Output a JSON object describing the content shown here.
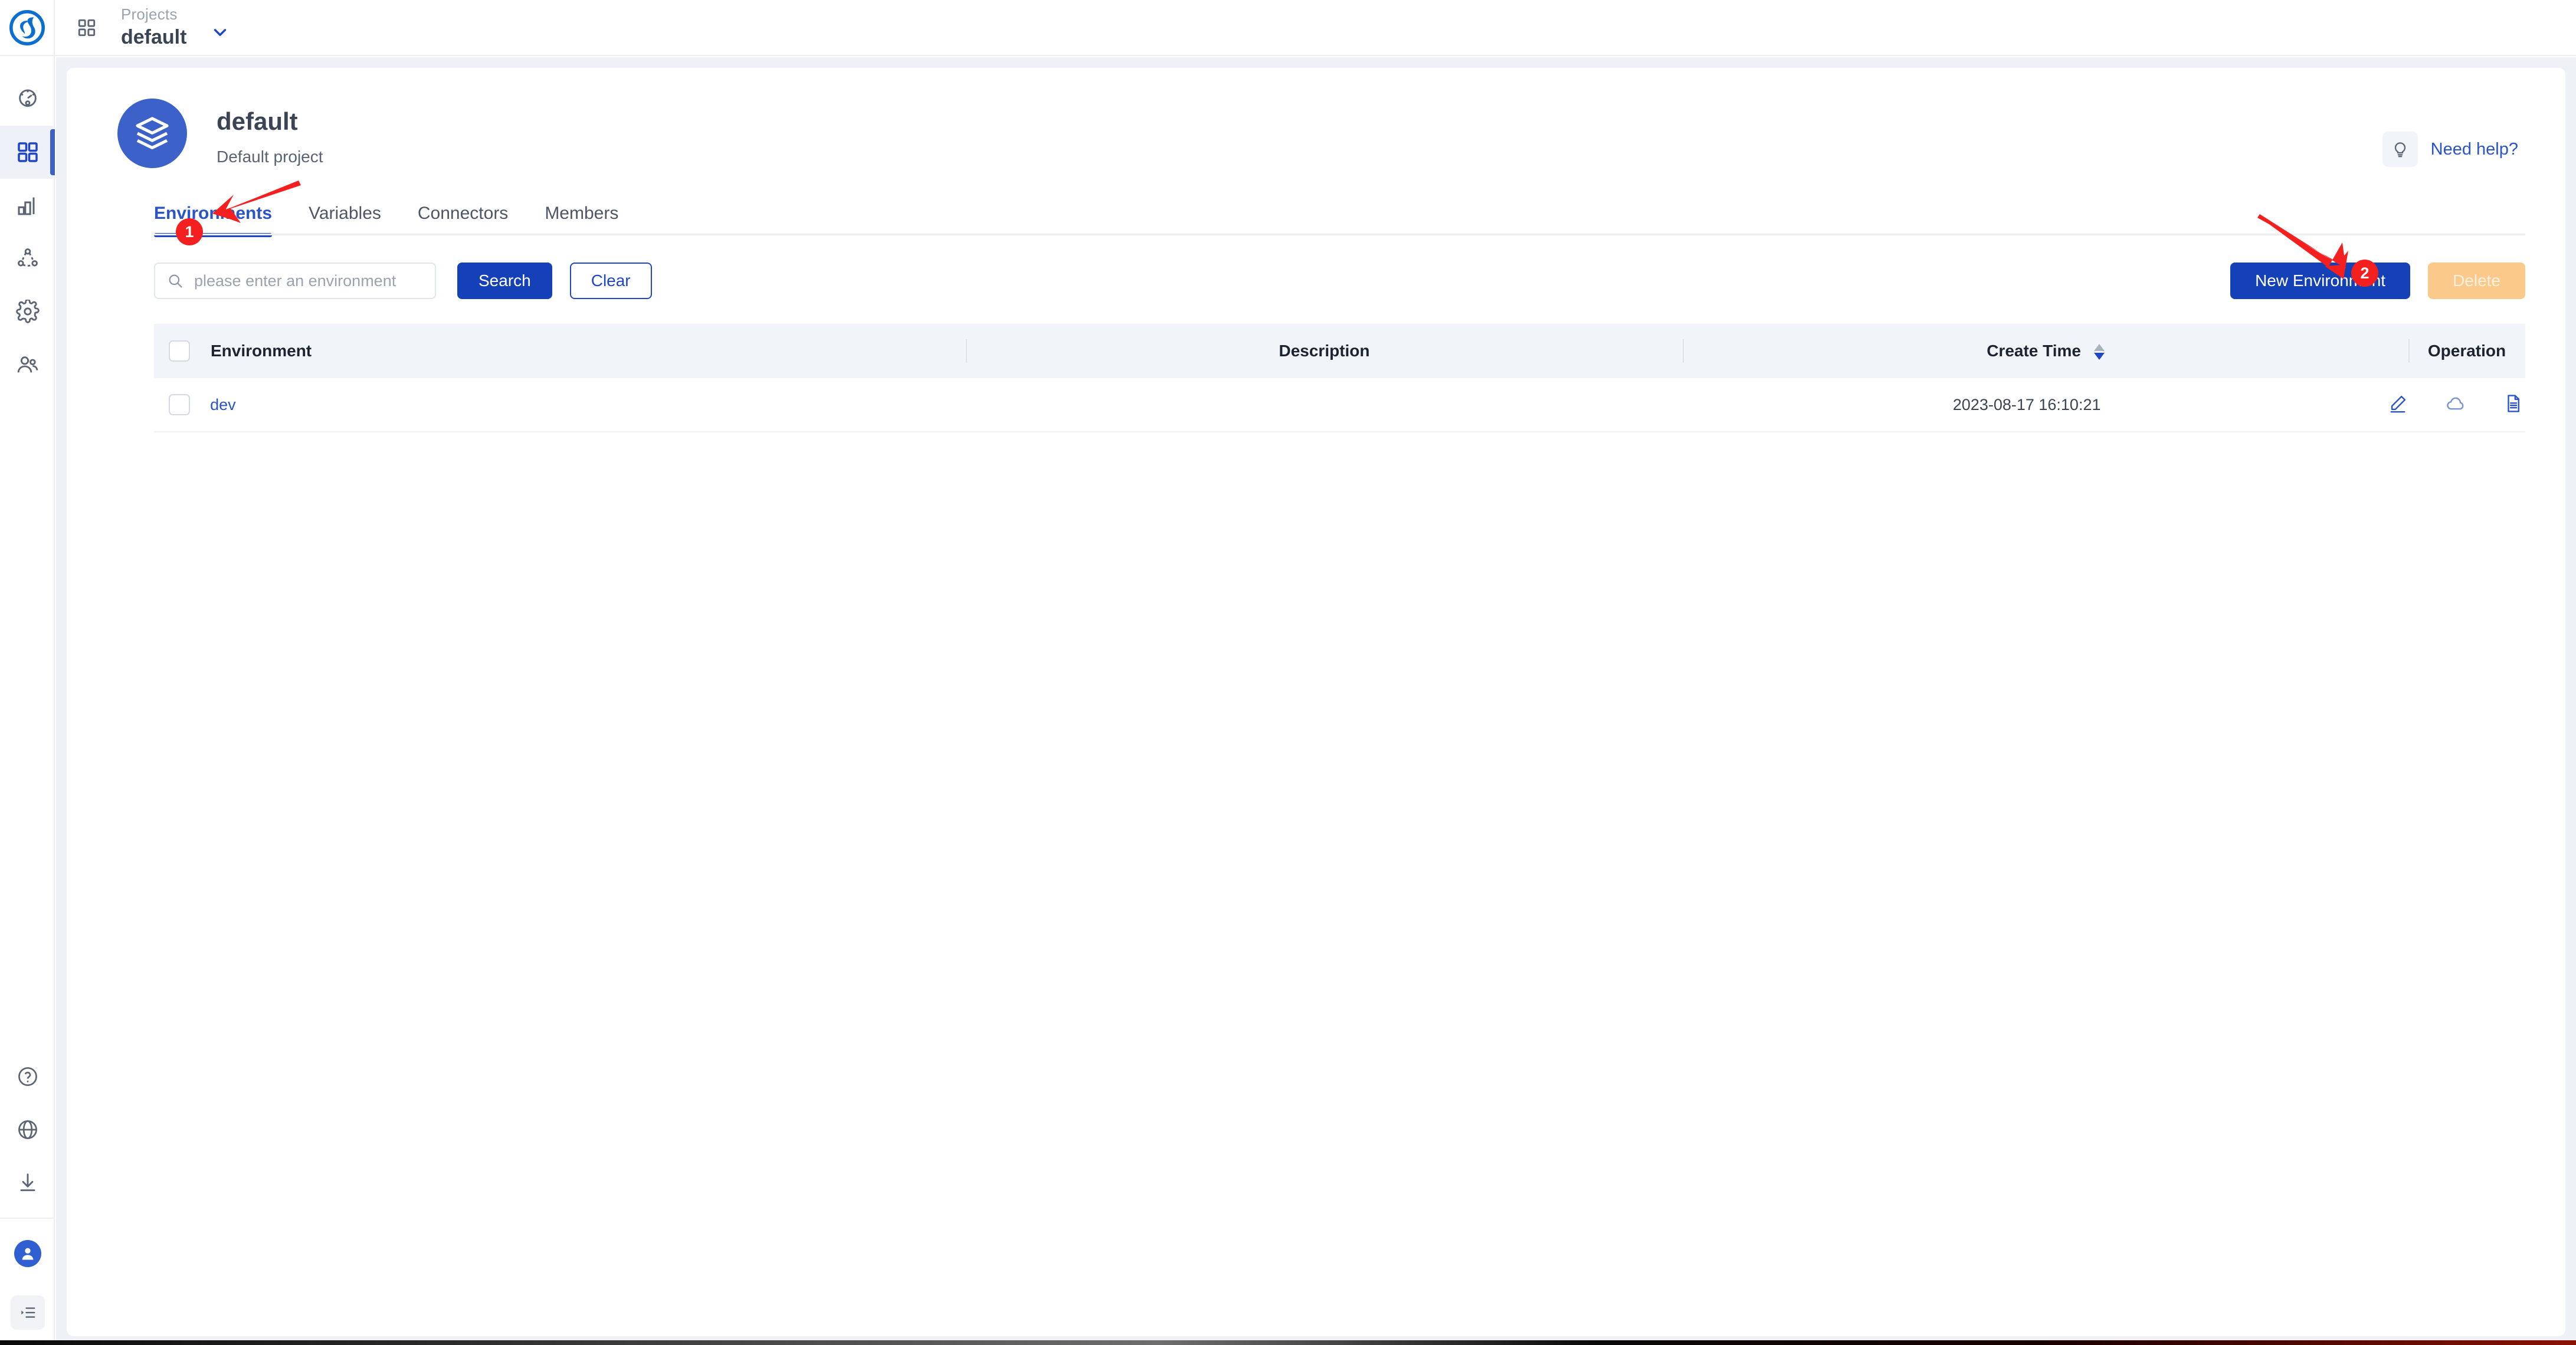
{
  "topbar": {
    "grid_icon": "grid-icon",
    "projects_label": "Projects",
    "project_name": "default",
    "caret_icon": "chevron-down-icon"
  },
  "sidebar": {
    "top_items": [
      {
        "name": "dashboard",
        "icon": "gauge-icon",
        "active": false
      },
      {
        "name": "projects",
        "icon": "grid-icon",
        "active": true
      },
      {
        "name": "analytics",
        "icon": "bar-chart-icon",
        "active": false
      },
      {
        "name": "topology",
        "icon": "network-icon",
        "active": false
      },
      {
        "name": "settings",
        "icon": "gear-icon",
        "active": false
      },
      {
        "name": "members",
        "icon": "users-icon",
        "active": false
      }
    ],
    "bottom_items": [
      {
        "name": "help",
        "icon": "question-circle-icon"
      },
      {
        "name": "language",
        "icon": "globe-icon"
      },
      {
        "name": "download",
        "icon": "download-icon"
      },
      {
        "name": "account",
        "icon": "user-avatar-icon"
      },
      {
        "name": "collapse",
        "icon": "collapse-menu-icon"
      }
    ]
  },
  "project": {
    "avatar_icon": "layers-stack-icon",
    "title": "default",
    "subtitle": "Default project"
  },
  "help": {
    "icon": "lightbulb-icon",
    "label": "Need help?"
  },
  "tabs": [
    {
      "label": "Environments",
      "active": true
    },
    {
      "label": "Variables",
      "active": false
    },
    {
      "label": "Connectors",
      "active": false
    },
    {
      "label": "Members",
      "active": false
    }
  ],
  "toolbar": {
    "search_icon": "search-icon",
    "search_value": "",
    "search_placeholder": "please enter an environment",
    "search_label": "Search",
    "clear_label": "Clear",
    "new_label": "New Environment",
    "delete_label": "Delete"
  },
  "table": {
    "columns": [
      "Environment",
      "Description",
      "Create Time",
      "Operation"
    ],
    "sort_column": "Create Time",
    "sort_direction": "desc",
    "rows": [
      {
        "environment": "dev",
        "description": "",
        "create_time": "2023-08-17 16:10:21",
        "operations": [
          "edit-icon",
          "cloud-icon",
          "file-list-icon"
        ]
      }
    ]
  },
  "annotations": [
    {
      "label": "1",
      "target": "Environments tab"
    },
    {
      "label": "2",
      "target": "New Environment button"
    }
  ],
  "colors": {
    "primary_blue": "#1440b8",
    "link_blue": "#2a53cc",
    "accent_indicator": "#3c62c9",
    "disabled_orange": "#fbc98a",
    "annotation_red": "#f41f1f",
    "canvas_gray": "#eef1f6",
    "header_row_gray": "#f1f4f9"
  }
}
